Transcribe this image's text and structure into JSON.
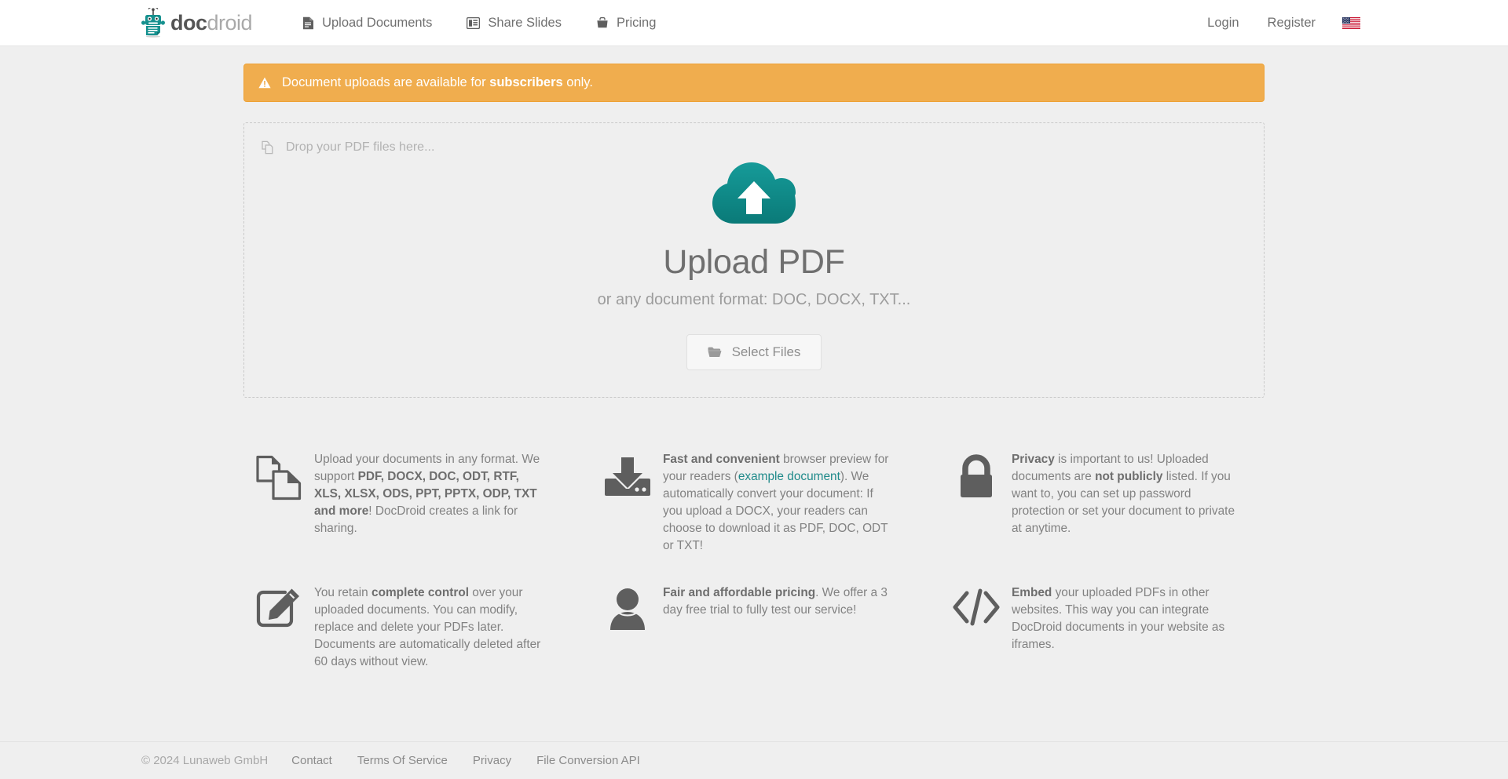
{
  "brand": {
    "part1": "doc",
    "part2": "droid",
    "logo_icon": "robot-logo-icon"
  },
  "nav": {
    "items": [
      {
        "label": "Upload Documents",
        "icon": "document-icon"
      },
      {
        "label": "Share Slides",
        "icon": "slides-icon"
      },
      {
        "label": "Pricing",
        "icon": "briefcase-icon"
      }
    ],
    "login_label": "Login",
    "register_label": "Register",
    "language_flag": "us-flag-icon"
  },
  "alert": {
    "icon": "warning-triangle-icon",
    "text_before": "Document uploads are available for ",
    "text_bold": "subscribers",
    "text_after": " only.",
    "bg_color": "#f0ad4e",
    "text_color": "#ffffff"
  },
  "dropzone": {
    "hint_icon": "copy-files-icon",
    "hint_text": "Drop your PDF files here...",
    "cloud_icon": "cloud-upload-icon",
    "cloud_color": "#0f8a8c",
    "title": "Upload PDF",
    "subtitle": "or any document format: DOC, DOCX, TXT...",
    "button_icon": "folder-open-icon",
    "button_label": "Select Files"
  },
  "features": [
    {
      "icon": "documents-stack-icon",
      "parts": [
        {
          "t": "Upload your documents in any format. We support ",
          "b": false
        },
        {
          "t": "PDF, DOCX, DOC, ODT, RTF, XLS, XLSX, ODS, PPT, PPTX, ODP, TXT and more",
          "b": true
        },
        {
          "t": "! DocDroid creates a link for sharing.",
          "b": false
        }
      ]
    },
    {
      "icon": "download-inbox-icon",
      "parts": [
        {
          "t": "Fast and convenient",
          "b": true
        },
        {
          "t": " browser preview for your readers (",
          "b": false
        },
        {
          "t": "example document",
          "link": true
        },
        {
          "t": "). We automatically convert your document: If you upload a DOCX, your readers can choose to download it as PDF, DOC, ODT or TXT!",
          "b": false
        }
      ]
    },
    {
      "icon": "lock-icon",
      "parts": [
        {
          "t": "Privacy",
          "b": true
        },
        {
          "t": " is important to us! Uploaded documents are ",
          "b": false
        },
        {
          "t": "not publicly",
          "b": true
        },
        {
          "t": " listed. If you want to, you can set up password protection or set your document to private at anytime.",
          "b": false
        }
      ]
    },
    {
      "icon": "edit-pencil-icon",
      "parts": [
        {
          "t": "You retain ",
          "b": false
        },
        {
          "t": "complete control",
          "b": true
        },
        {
          "t": " over your uploaded documents. You can modify, replace and delete your PDFs later. Documents are automatically deleted after 60 days without view.",
          "b": false
        }
      ]
    },
    {
      "icon": "user-icon",
      "parts": [
        {
          "t": "Fair and affordable pricing",
          "b": true
        },
        {
          "t": ". We offer a 3 day free trial to fully test our service!",
          "b": false
        }
      ]
    },
    {
      "icon": "code-embed-icon",
      "parts": [
        {
          "t": "Embed",
          "b": true
        },
        {
          "t": " your uploaded PDFs in other websites. This way you can integrate DocDroid documents in your website as iframes.",
          "b": false
        }
      ]
    }
  ],
  "footer": {
    "copyright": "© 2024 Lunaweb GmbH",
    "links": [
      {
        "label": "Contact"
      },
      {
        "label": "Terms Of Service"
      },
      {
        "label": "Privacy"
      },
      {
        "label": "File Conversion API"
      }
    ]
  }
}
